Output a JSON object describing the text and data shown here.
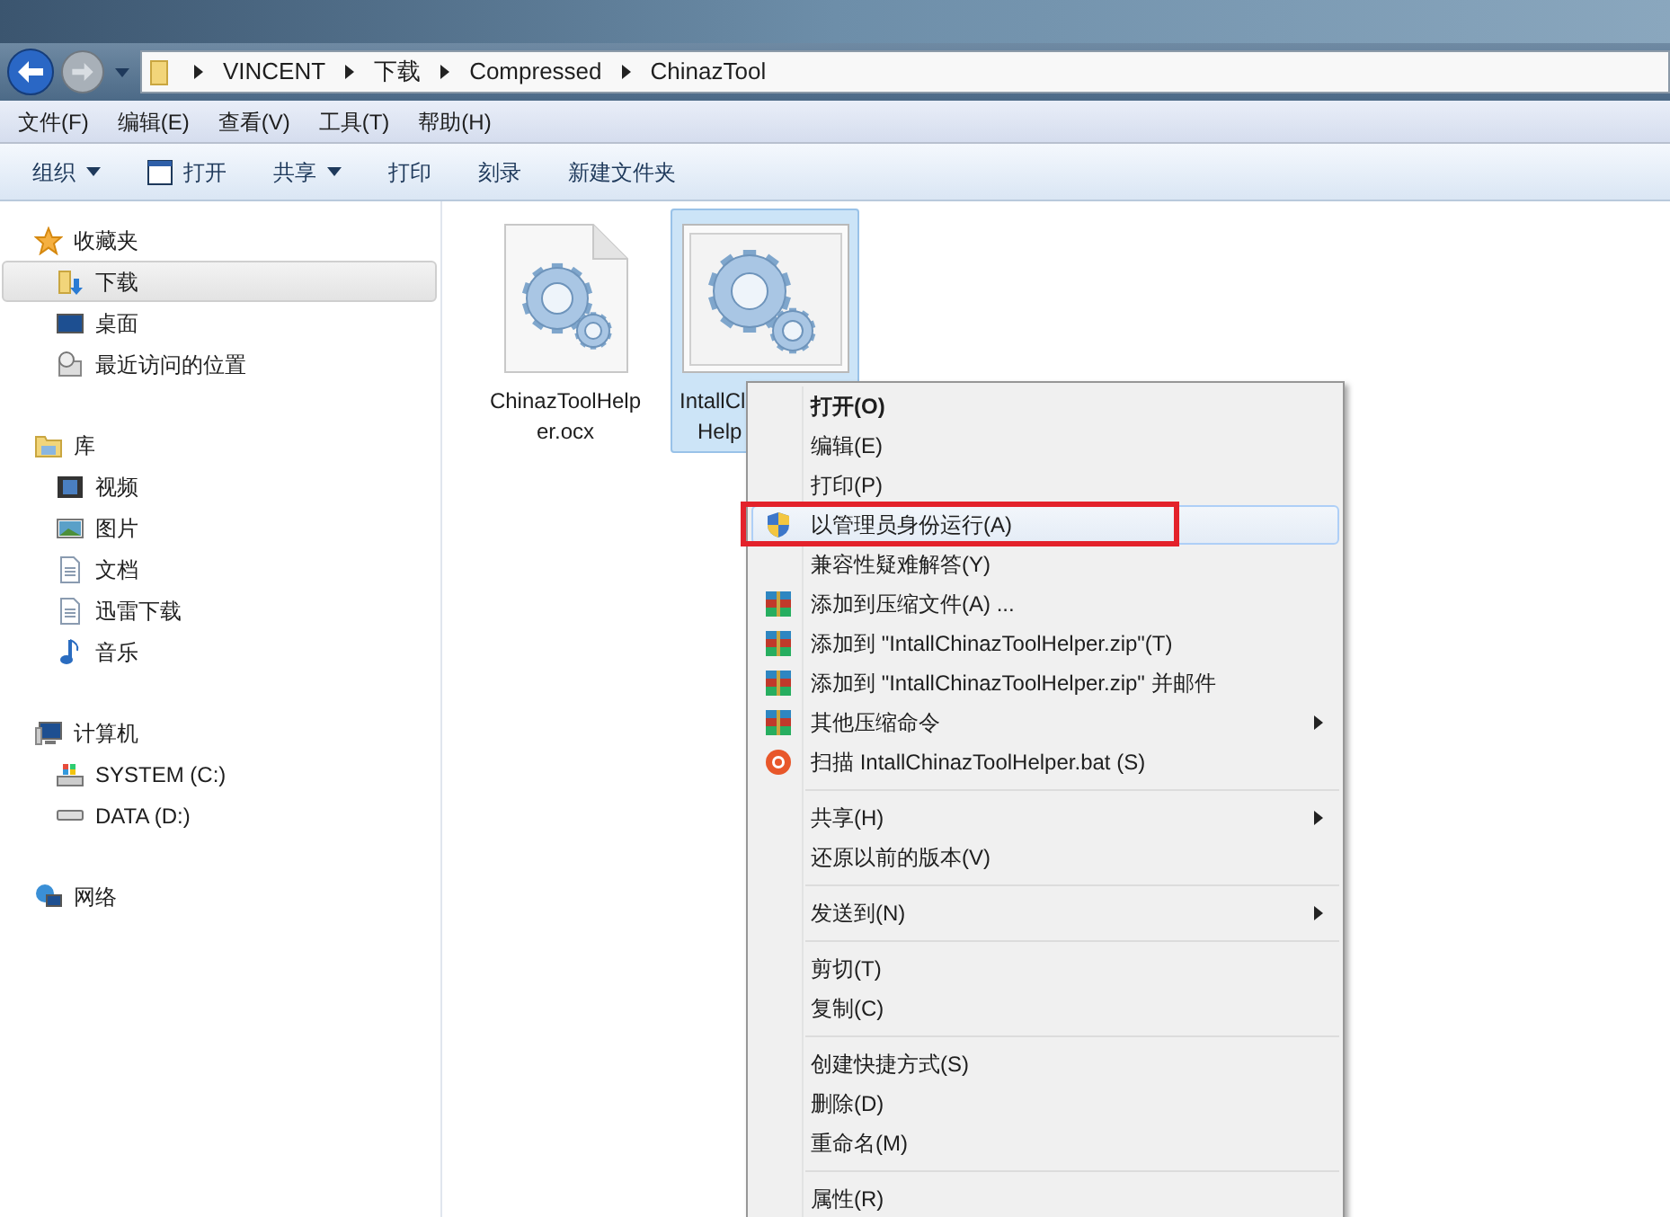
{
  "address_bar": {
    "path": [
      "VINCENT",
      "下载",
      "Compressed",
      "ChinazTool"
    ]
  },
  "menu_bar": [
    "文件(F)",
    "编辑(E)",
    "查看(V)",
    "工具(T)",
    "帮助(H)"
  ],
  "toolbar": [
    {
      "label": "组织",
      "kind": "dropdown"
    },
    {
      "label": "打开",
      "kind": "icon"
    },
    {
      "label": "共享",
      "kind": "dropdown"
    },
    {
      "label": "打印",
      "kind": "plain"
    },
    {
      "label": "刻录",
      "kind": "plain"
    },
    {
      "label": "新建文件夹",
      "kind": "plain"
    }
  ],
  "sidebar": {
    "groups": [
      {
        "label": "收藏夹",
        "kind": "star",
        "children": [
          {
            "label": "下载",
            "kind": "download",
            "selected": true
          },
          {
            "label": "桌面",
            "kind": "desktop",
            "selected": false
          },
          {
            "label": "最近访问的位置",
            "kind": "recent",
            "selected": false
          }
        ]
      },
      {
        "label": "库",
        "kind": "library",
        "children": [
          {
            "label": "视频",
            "kind": "video",
            "selected": false
          },
          {
            "label": "图片",
            "kind": "picture",
            "selected": false
          },
          {
            "label": "文档",
            "kind": "document",
            "selected": false
          },
          {
            "label": "迅雷下载",
            "kind": "document",
            "selected": false
          },
          {
            "label": "音乐",
            "kind": "music",
            "selected": false
          }
        ]
      },
      {
        "label": "计算机",
        "kind": "computer",
        "children": [
          {
            "label": "SYSTEM (C:)",
            "kind": "system-drive",
            "selected": false
          },
          {
            "label": "DATA (D:)",
            "kind": "drive",
            "selected": false
          }
        ]
      },
      {
        "label": "网络",
        "kind": "network"
      }
    ]
  },
  "files": [
    {
      "lines": [
        "ChinazToolHelp",
        "er.ocx"
      ],
      "kind": "document",
      "selected": false
    },
    {
      "lines": [
        "IntallCl",
        "Help"
      ],
      "kind": "window",
      "selected": true
    }
  ],
  "context_menu": {
    "items": [
      {
        "kind": "bold",
        "label": "打开(O)",
        "highlighted": false
      },
      {
        "kind": "plain",
        "label": "编辑(E)",
        "highlighted": false
      },
      {
        "kind": "plain",
        "label": "打印(P)",
        "highlighted": false
      },
      {
        "kind": "shield",
        "label": "以管理员身份运行(A)",
        "highlighted": true
      },
      {
        "kind": "plain",
        "label": "兼容性疑难解答(Y)",
        "highlighted": false
      },
      {
        "kind": "archive",
        "label": "添加到压缩文件(A) ...",
        "highlighted": false
      },
      {
        "kind": "archive",
        "label": "添加到 \"IntallChinazToolHelper.zip\"(T)",
        "highlighted": false
      },
      {
        "kind": "archive",
        "label": "添加到 \"IntallChinazToolHelper.zip\" 并邮件",
        "highlighted": false
      },
      {
        "kind": "archive-submenu",
        "label": "其他压缩命令",
        "highlighted": false
      },
      {
        "kind": "scan",
        "label": "扫描 IntallChinazToolHelper.bat (S)",
        "highlighted": false
      },
      {
        "kind": "separator"
      },
      {
        "kind": "submenu",
        "label": "共享(H)",
        "highlighted": false
      },
      {
        "kind": "plain",
        "label": "还原以前的版本(V)",
        "highlighted": false
      },
      {
        "kind": "separator"
      },
      {
        "kind": "submenu",
        "label": "发送到(N)",
        "highlighted": false
      },
      {
        "kind": "separator"
      },
      {
        "kind": "plain",
        "label": "剪切(T)",
        "highlighted": false
      },
      {
        "kind": "plain",
        "label": "复制(C)",
        "highlighted": false
      },
      {
        "kind": "separator"
      },
      {
        "kind": "plain",
        "label": "创建快捷方式(S)",
        "highlighted": false
      },
      {
        "kind": "plain",
        "label": "删除(D)",
        "highlighted": false
      },
      {
        "kind": "plain",
        "label": "重命名(M)",
        "highlighted": false
      },
      {
        "kind": "separator"
      },
      {
        "kind": "plain",
        "label": "属性(R)",
        "highlighted": false
      }
    ]
  }
}
